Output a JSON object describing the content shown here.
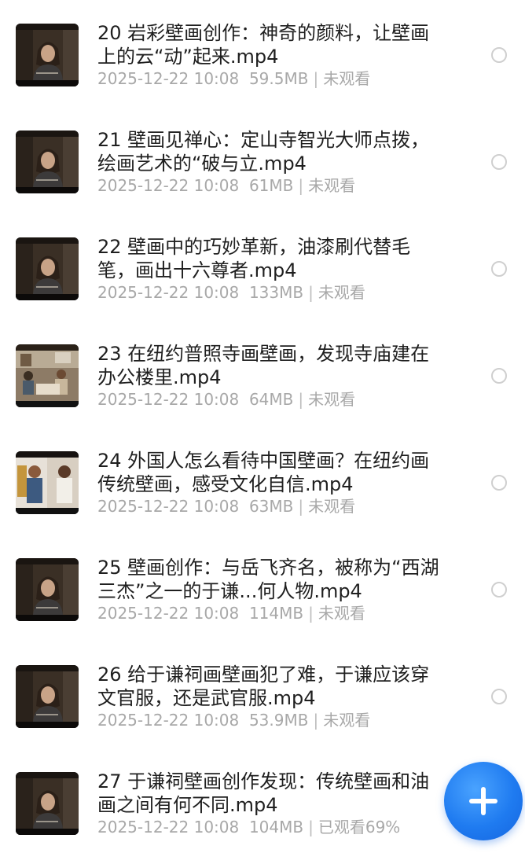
{
  "items": [
    {
      "title": "20 岩彩壁画创作：神奇的颜料，让壁画上的云“动”起来.mp4",
      "date": "2025-12-22 10:08",
      "size": "59.5MB",
      "status": "未观看",
      "thumb": "portrait"
    },
    {
      "title": "21 壁画见禅心：定山寺智光大师点拨，绘画艺术的“破与立.mp4",
      "date": "2025-12-22 10:08",
      "size": "61MB",
      "status": "未观看",
      "thumb": "portrait"
    },
    {
      "title": "22 壁画中的巧妙革新，油漆刷代替毛笔，画出十六尊者.mp4",
      "date": "2025-12-22 10:08",
      "size": "133MB",
      "status": "未观看",
      "thumb": "portrait"
    },
    {
      "title": "23 在纽约普照寺画壁画，发现寺庙建在办公楼里.mp4",
      "date": "2025-12-22 10:08",
      "size": "64MB",
      "status": "未观看",
      "thumb": "office"
    },
    {
      "title": "24 外国人怎么看待中国壁画？在纽约画传统壁画，感受文化自信.mp4",
      "date": "2025-12-22 10:08",
      "size": "63MB",
      "status": "未观看",
      "thumb": "people"
    },
    {
      "title": "25 壁画创作：与岳飞齐名，被称为“西湖三杰”之一的于谦...何人物.mp4",
      "date": "2025-12-22 10:08",
      "size": "114MB",
      "status": "未观看",
      "thumb": "portrait"
    },
    {
      "title": "26 给于谦祠画壁画犯了难，于谦应该穿文官服，还是武官服.mp4",
      "date": "2025-12-22 10:08",
      "size": "53.9MB",
      "status": "未观看",
      "thumb": "portrait"
    },
    {
      "title": "27 于谦祠壁画创作发现：传统壁画和油画之间有何不同.mp4",
      "date": "2025-12-22 10:08",
      "size": "104MB",
      "status": "已观看69%",
      "thumb": "portrait"
    }
  ],
  "icons": {
    "select": "radio-circle-icon",
    "add": "plus-icon"
  },
  "colors": {
    "accent": "#1f7bf0",
    "meta_text": "#a8a8a8",
    "title_text": "#1f1f1f"
  }
}
